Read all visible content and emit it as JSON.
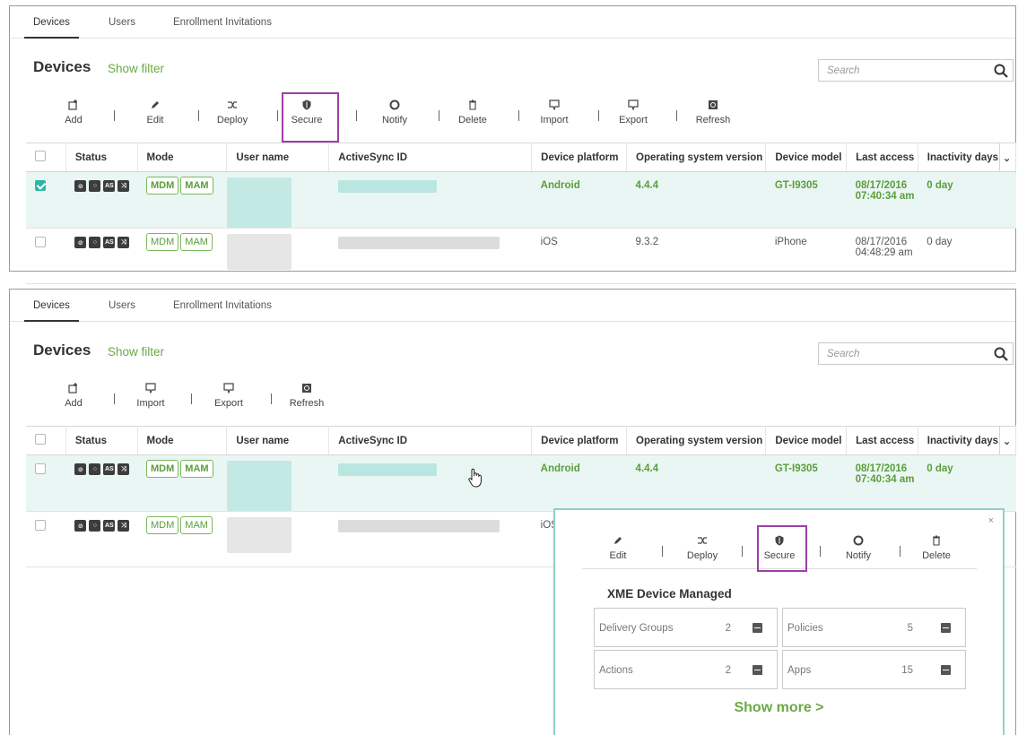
{
  "tabs": [
    "Devices",
    "Users",
    "Enrollment Invitations"
  ],
  "page_title": "Devices",
  "show_filter": "Show filter",
  "search_placeholder": "Search",
  "toolbar_full": [
    "Add",
    "Edit",
    "Deploy",
    "Secure",
    "Notify",
    "Delete",
    "Import",
    "Export",
    "Refresh"
  ],
  "toolbar_short": [
    "Add",
    "Import",
    "Export",
    "Refresh"
  ],
  "columns": [
    "Status",
    "Mode",
    "User name",
    "ActiveSync ID",
    "Device platform",
    "Operating system version",
    "Device model",
    "Last access",
    "Inactivity days"
  ],
  "mode_labels": [
    "MDM",
    "MAM"
  ],
  "status_icons": [
    "lock-status-icon",
    "circle-status-icon",
    "as-status-icon",
    "deploy-status-icon"
  ],
  "rows": [
    {
      "platform": "Android",
      "os": "4.4.4",
      "model": "GT-I9305",
      "date": "08/17/2016",
      "time": "07:40:34 am",
      "inactive": "0 day",
      "selected": true
    },
    {
      "platform": "iOS",
      "os": "9.3.2",
      "model": "iPhone",
      "date": "08/17/2016",
      "time": "04:48:29 am",
      "inactive": "0 day",
      "selected": false
    }
  ],
  "popup": {
    "actions": [
      "Edit",
      "Deploy",
      "Secure",
      "Notify",
      "Delete"
    ],
    "title": "XME Device Managed",
    "stats": [
      {
        "label": "Delivery Groups",
        "value": "2"
      },
      {
        "label": "Policies",
        "value": "5"
      },
      {
        "label": "Actions",
        "value": "2"
      },
      {
        "label": "Apps",
        "value": "15"
      }
    ],
    "show_more": "Show more >",
    "close": "×"
  },
  "colors": {
    "accent": "#6aaa46",
    "highlight": "#9a3fa6",
    "selected_row": "#eaf6f4",
    "popup_border": "#8fd2c7"
  }
}
